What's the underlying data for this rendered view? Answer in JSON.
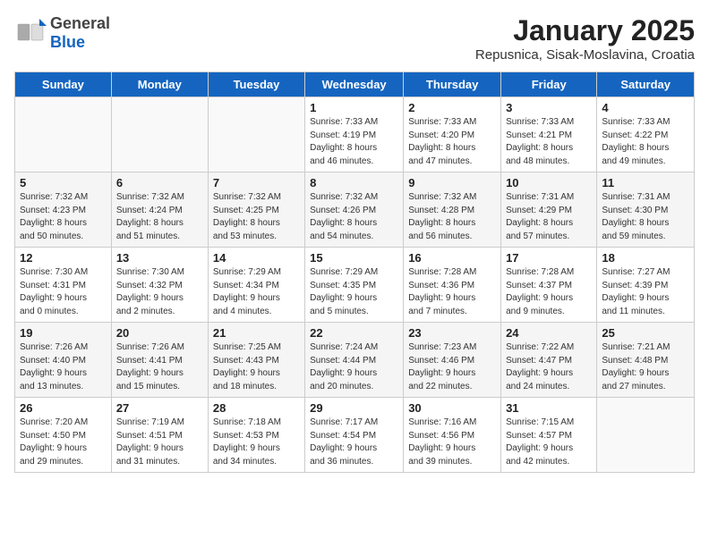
{
  "header": {
    "logo_general": "General",
    "logo_blue": "Blue",
    "title": "January 2025",
    "subtitle": "Repusnica, Sisak-Moslavina, Croatia"
  },
  "weekdays": [
    "Sunday",
    "Monday",
    "Tuesday",
    "Wednesday",
    "Thursday",
    "Friday",
    "Saturday"
  ],
  "weeks": [
    [
      {
        "day": "",
        "info": ""
      },
      {
        "day": "",
        "info": ""
      },
      {
        "day": "",
        "info": ""
      },
      {
        "day": "1",
        "info": "Sunrise: 7:33 AM\nSunset: 4:19 PM\nDaylight: 8 hours\nand 46 minutes."
      },
      {
        "day": "2",
        "info": "Sunrise: 7:33 AM\nSunset: 4:20 PM\nDaylight: 8 hours\nand 47 minutes."
      },
      {
        "day": "3",
        "info": "Sunrise: 7:33 AM\nSunset: 4:21 PM\nDaylight: 8 hours\nand 48 minutes."
      },
      {
        "day": "4",
        "info": "Sunrise: 7:33 AM\nSunset: 4:22 PM\nDaylight: 8 hours\nand 49 minutes."
      }
    ],
    [
      {
        "day": "5",
        "info": "Sunrise: 7:32 AM\nSunset: 4:23 PM\nDaylight: 8 hours\nand 50 minutes."
      },
      {
        "day": "6",
        "info": "Sunrise: 7:32 AM\nSunset: 4:24 PM\nDaylight: 8 hours\nand 51 minutes."
      },
      {
        "day": "7",
        "info": "Sunrise: 7:32 AM\nSunset: 4:25 PM\nDaylight: 8 hours\nand 53 minutes."
      },
      {
        "day": "8",
        "info": "Sunrise: 7:32 AM\nSunset: 4:26 PM\nDaylight: 8 hours\nand 54 minutes."
      },
      {
        "day": "9",
        "info": "Sunrise: 7:32 AM\nSunset: 4:28 PM\nDaylight: 8 hours\nand 56 minutes."
      },
      {
        "day": "10",
        "info": "Sunrise: 7:31 AM\nSunset: 4:29 PM\nDaylight: 8 hours\nand 57 minutes."
      },
      {
        "day": "11",
        "info": "Sunrise: 7:31 AM\nSunset: 4:30 PM\nDaylight: 8 hours\nand 59 minutes."
      }
    ],
    [
      {
        "day": "12",
        "info": "Sunrise: 7:30 AM\nSunset: 4:31 PM\nDaylight: 9 hours\nand 0 minutes."
      },
      {
        "day": "13",
        "info": "Sunrise: 7:30 AM\nSunset: 4:32 PM\nDaylight: 9 hours\nand 2 minutes."
      },
      {
        "day": "14",
        "info": "Sunrise: 7:29 AM\nSunset: 4:34 PM\nDaylight: 9 hours\nand 4 minutes."
      },
      {
        "day": "15",
        "info": "Sunrise: 7:29 AM\nSunset: 4:35 PM\nDaylight: 9 hours\nand 5 minutes."
      },
      {
        "day": "16",
        "info": "Sunrise: 7:28 AM\nSunset: 4:36 PM\nDaylight: 9 hours\nand 7 minutes."
      },
      {
        "day": "17",
        "info": "Sunrise: 7:28 AM\nSunset: 4:37 PM\nDaylight: 9 hours\nand 9 minutes."
      },
      {
        "day": "18",
        "info": "Sunrise: 7:27 AM\nSunset: 4:39 PM\nDaylight: 9 hours\nand 11 minutes."
      }
    ],
    [
      {
        "day": "19",
        "info": "Sunrise: 7:26 AM\nSunset: 4:40 PM\nDaylight: 9 hours\nand 13 minutes."
      },
      {
        "day": "20",
        "info": "Sunrise: 7:26 AM\nSunset: 4:41 PM\nDaylight: 9 hours\nand 15 minutes."
      },
      {
        "day": "21",
        "info": "Sunrise: 7:25 AM\nSunset: 4:43 PM\nDaylight: 9 hours\nand 18 minutes."
      },
      {
        "day": "22",
        "info": "Sunrise: 7:24 AM\nSunset: 4:44 PM\nDaylight: 9 hours\nand 20 minutes."
      },
      {
        "day": "23",
        "info": "Sunrise: 7:23 AM\nSunset: 4:46 PM\nDaylight: 9 hours\nand 22 minutes."
      },
      {
        "day": "24",
        "info": "Sunrise: 7:22 AM\nSunset: 4:47 PM\nDaylight: 9 hours\nand 24 minutes."
      },
      {
        "day": "25",
        "info": "Sunrise: 7:21 AM\nSunset: 4:48 PM\nDaylight: 9 hours\nand 27 minutes."
      }
    ],
    [
      {
        "day": "26",
        "info": "Sunrise: 7:20 AM\nSunset: 4:50 PM\nDaylight: 9 hours\nand 29 minutes."
      },
      {
        "day": "27",
        "info": "Sunrise: 7:19 AM\nSunset: 4:51 PM\nDaylight: 9 hours\nand 31 minutes."
      },
      {
        "day": "28",
        "info": "Sunrise: 7:18 AM\nSunset: 4:53 PM\nDaylight: 9 hours\nand 34 minutes."
      },
      {
        "day": "29",
        "info": "Sunrise: 7:17 AM\nSunset: 4:54 PM\nDaylight: 9 hours\nand 36 minutes."
      },
      {
        "day": "30",
        "info": "Sunrise: 7:16 AM\nSunset: 4:56 PM\nDaylight: 9 hours\nand 39 minutes."
      },
      {
        "day": "31",
        "info": "Sunrise: 7:15 AM\nSunset: 4:57 PM\nDaylight: 9 hours\nand 42 minutes."
      },
      {
        "day": "",
        "info": ""
      }
    ]
  ]
}
